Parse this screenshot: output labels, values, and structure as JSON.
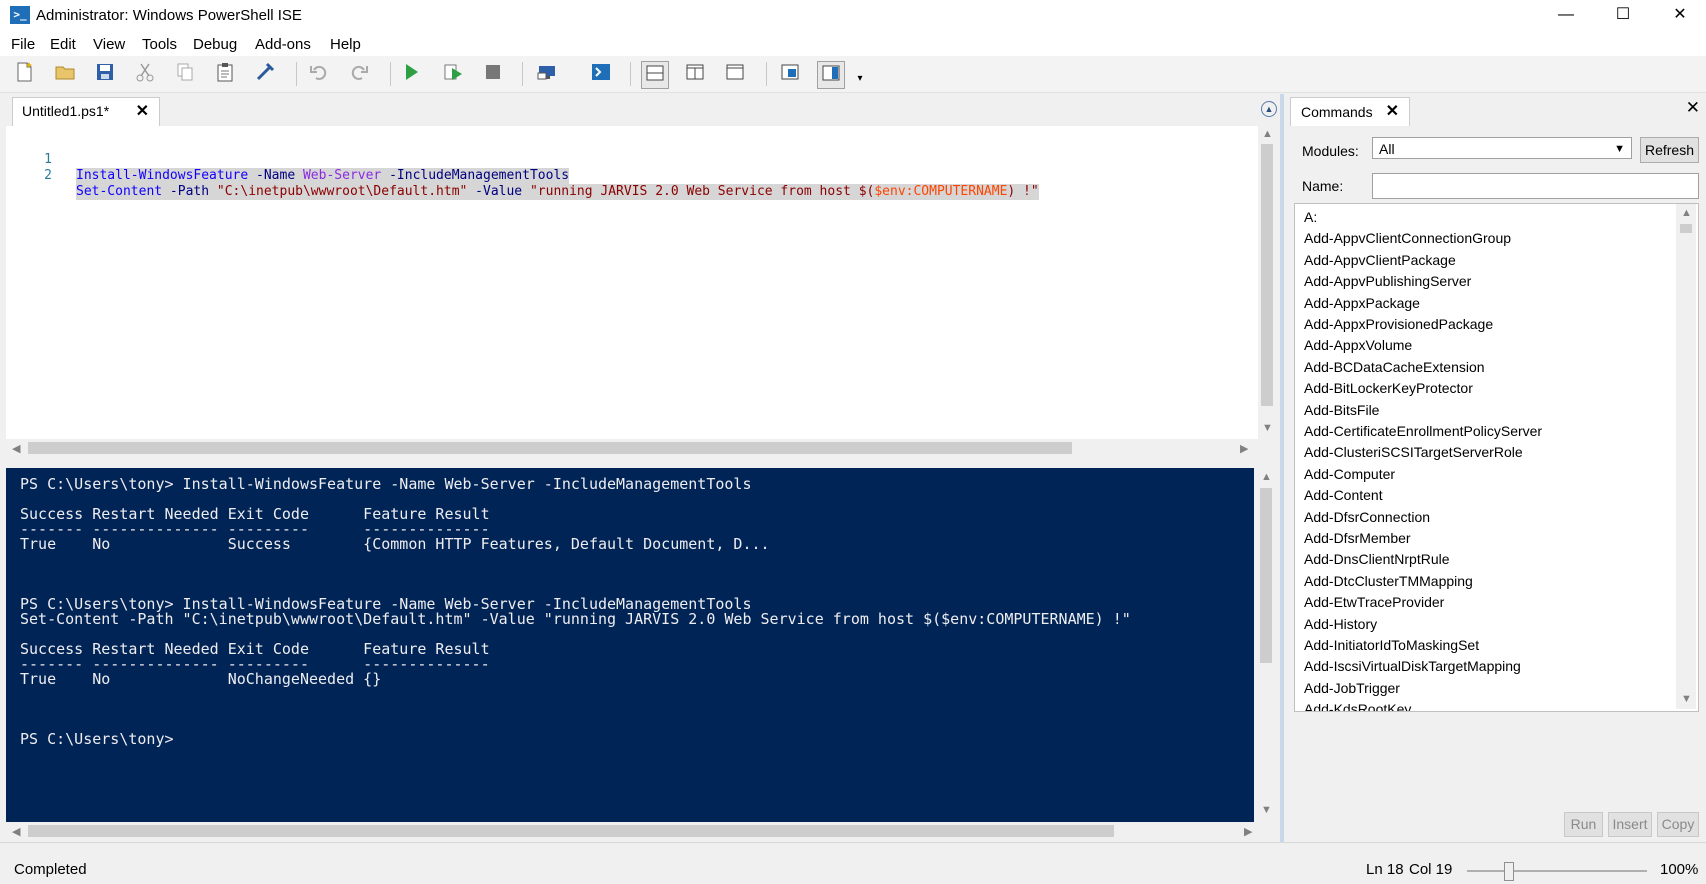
{
  "window": {
    "title": "Administrator: Windows PowerShell ISE",
    "minimize": "—",
    "maximize": "☐",
    "close": "✕"
  },
  "menu": [
    "File",
    "Edit",
    "View",
    "Tools",
    "Debug",
    "Add-ons",
    "Help"
  ],
  "toolbar_icons": [
    "new-icon",
    "open-icon",
    "save-icon",
    "cut-icon",
    "copy-icon",
    "paste-icon",
    "clear-icon",
    "undo-icon",
    "redo-icon",
    "run-icon",
    "run-selection-icon",
    "stop-icon",
    "remote-powershell-icon",
    "powershell-console-icon",
    "layout-top-icon",
    "layout-right-icon",
    "layout-max-icon",
    "addon-icon",
    "show-commands-icon",
    "overflow-icon"
  ],
  "editor": {
    "tab_title": "Untitled1.ps1*",
    "tab_close": "✕",
    "lines": [
      {
        "num": "1",
        "tokens": [
          {
            "t": "Install-WindowsFeature",
            "k": "cmd"
          },
          {
            "t": " ",
            "k": "op"
          },
          {
            "t": "-Name",
            "k": "par"
          },
          {
            "t": " ",
            "k": "op"
          },
          {
            "t": "Web-Server",
            "k": "arg"
          },
          {
            "t": " ",
            "k": "op"
          },
          {
            "t": "-IncludeManagementTools",
            "k": "par"
          }
        ]
      },
      {
        "num": "2",
        "tokens": [
          {
            "t": "Set-Content",
            "k": "cmd"
          },
          {
            "t": " ",
            "k": "op"
          },
          {
            "t": "-Path",
            "k": "par"
          },
          {
            "t": " ",
            "k": "op"
          },
          {
            "t": "\"C:\\inetpub\\wwwroot\\Default.htm\"",
            "k": "str"
          },
          {
            "t": " ",
            "k": "op"
          },
          {
            "t": "-Value",
            "k": "par"
          },
          {
            "t": " ",
            "k": "op"
          },
          {
            "t": "\"running JARVIS 2.0 Web Service from host $(",
            "k": "str"
          },
          {
            "t": "$env:COMPUTERNAME",
            "k": "var"
          },
          {
            "t": ") !\"",
            "k": "str"
          }
        ]
      }
    ]
  },
  "console": {
    "lines": [
      "PS C:\\Users\\tony> Install-WindowsFeature -Name Web-Server -IncludeManagementTools",
      "",
      "Success Restart Needed Exit Code      Feature Result",
      "------- -------------- ---------      --------------",
      "True    No             Success        {Common HTTP Features, Default Document, D...",
      "",
      "",
      "",
      "PS C:\\Users\\tony> Install-WindowsFeature -Name Web-Server -IncludeManagementTools",
      "Set-Content -Path \"C:\\inetpub\\wwwroot\\Default.htm\" -Value \"running JARVIS 2.0 Web Service from host $($env:COMPUTERNAME) !\"",
      "",
      "Success Restart Needed Exit Code      Feature Result",
      "------- -------------- ---------      --------------",
      "True    No             NoChangeNeeded {}",
      "",
      "",
      "",
      "PS C:\\Users\\tony>"
    ]
  },
  "commands": {
    "tab_title": "Commands",
    "tab_close": "✕",
    "pane_close": "✕",
    "modules_label": "Modules:",
    "modules_value": "All",
    "refresh_label": "Refresh",
    "name_label": "Name:",
    "name_value": "",
    "items": [
      "A:",
      "Add-AppvClientConnectionGroup",
      "Add-AppvClientPackage",
      "Add-AppvPublishingServer",
      "Add-AppxPackage",
      "Add-AppxProvisionedPackage",
      "Add-AppxVolume",
      "Add-BCDataCacheExtension",
      "Add-BitLockerKeyProtector",
      "Add-BitsFile",
      "Add-CertificateEnrollmentPolicyServer",
      "Add-ClusteriSCSITargetServerRole",
      "Add-Computer",
      "Add-Content",
      "Add-DfsrConnection",
      "Add-DfsrMember",
      "Add-DnsClientNrptRule",
      "Add-DtcClusterTMMapping",
      "Add-EtwTraceProvider",
      "Add-History",
      "Add-InitiatorIdToMaskingSet",
      "Add-IscsiVirtualDiskTargetMapping",
      "Add-JobTrigger",
      "Add-KdsRootKey"
    ],
    "run_label": "Run",
    "insert_label": "Insert",
    "copy_label": "Copy"
  },
  "status": {
    "text": "Completed",
    "ln": "Ln 18",
    "col": "Col 19",
    "zoom": "100%",
    "zoom_level": 1.0
  }
}
